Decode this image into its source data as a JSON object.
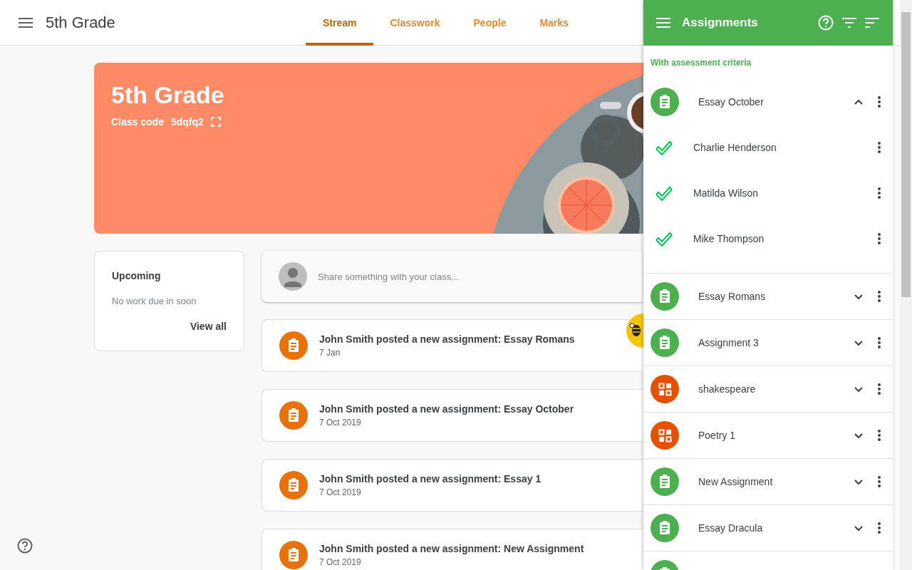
{
  "app_bar": {
    "title": "5th Grade"
  },
  "tabs": [
    {
      "label": "Stream",
      "selected": true
    },
    {
      "label": "Classwork",
      "selected": false
    },
    {
      "label": "People",
      "selected": false
    },
    {
      "label": "Marks",
      "selected": false
    }
  ],
  "banner": {
    "title": "5th Grade",
    "class_code_label": "Class code",
    "class_code": "5dqfq2"
  },
  "upcoming": {
    "title": "Upcoming",
    "message": "No work due in soon",
    "link": "View all"
  },
  "composer": {
    "placeholder": "Share something with your class..."
  },
  "posts": [
    {
      "text": "John Smith posted a new assignment: Essay Romans",
      "date": "7 Jan"
    },
    {
      "text": "John Smith posted a new assignment: Essay October",
      "date": "7 Oct 2019"
    },
    {
      "text": "John Smith posted a new assignment: Essay 1",
      "date": "7 Oct 2019"
    },
    {
      "text": "John Smith posted a new assignment: New Assignment",
      "date": "7 Oct 2019"
    }
  ],
  "panel": {
    "title": "Assignments",
    "section": "With assessment criteria",
    "items": [
      {
        "kind": "assignment",
        "title": "Essay October",
        "expanded": true,
        "children": [
          {
            "name": "Charlie Henderson",
            "done": true
          },
          {
            "name": "Matilda Wilson",
            "done": true
          },
          {
            "name": "Mike Thompson",
            "done": true
          }
        ]
      },
      {
        "kind": "assignment",
        "title": "Essay Romans",
        "expanded": false
      },
      {
        "kind": "assignment",
        "title": "Assignment 3",
        "expanded": false
      },
      {
        "kind": "grid",
        "title": "shakespeare",
        "expanded": false
      },
      {
        "kind": "grid",
        "title": "Poetry 1",
        "expanded": false
      },
      {
        "kind": "assignment",
        "title": "New Assignment",
        "expanded": false
      },
      {
        "kind": "assignment",
        "title": "Essay Dracula",
        "expanded": false
      },
      {
        "kind": "assignment"
      }
    ]
  }
}
